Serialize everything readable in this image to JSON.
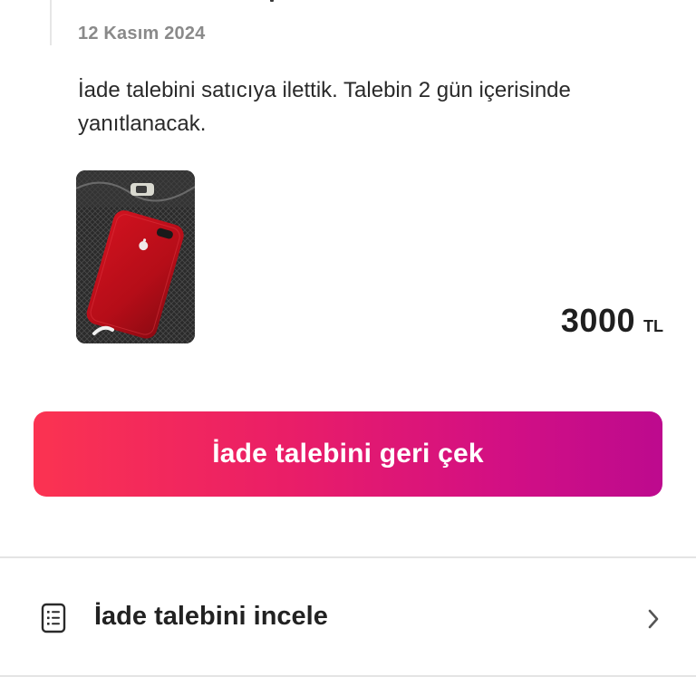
{
  "event": {
    "date": "12 Kasım 2024",
    "message": "İade talebini satıcıya ilettik. Talebin 2 gün içerisinde yanıtlanacak."
  },
  "product": {
    "image_icon": "red-phone-photo",
    "price_amount": "3000",
    "price_currency": "TL"
  },
  "actions": {
    "withdraw_label": "İade talebini geri çek",
    "review_label": "İade talebini incele",
    "review_icon": "document-list-icon",
    "chevron_icon": "chevron-right-icon"
  },
  "colors": {
    "button_gradient_start": "#fb3351",
    "button_gradient_end": "#bd0a8e",
    "date_text": "#8a8a8a",
    "divider": "#e4e4e4"
  }
}
